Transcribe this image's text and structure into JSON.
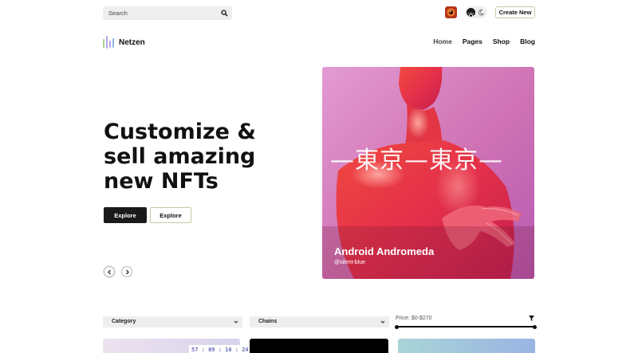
{
  "topbar": {
    "search_placeholder": "Search",
    "create_label": "Create New"
  },
  "brand": {
    "name": "Netzen",
    "logo_colors": [
      "#a9d18e",
      "#b8a6e8",
      "#8fb4ea"
    ]
  },
  "nav": {
    "items": [
      {
        "label": "Home",
        "active": true
      },
      {
        "label": "Pages",
        "active": false
      },
      {
        "label": "Shop",
        "active": false
      },
      {
        "label": "Blog",
        "active": false
      }
    ]
  },
  "hero": {
    "title_lines": [
      "Customize &",
      "sell amazing",
      "new NFTs"
    ],
    "primary_button": "Explore",
    "secondary_button": "Explore"
  },
  "featured": {
    "overlay_text": "—東京—東京—",
    "title": "Android Andromeda",
    "handle": "@silent-blue"
  },
  "filters": {
    "category_label": "Category",
    "chains_label": "Chains",
    "price_label": "Price:",
    "price_range": "$0-$270"
  },
  "cards": {
    "timer": "57 : 09 : 16 : 24"
  },
  "colors": {
    "accent_dark": "#1a1a1a",
    "outline": "#c9c9a8",
    "timer_text": "#6a6ab8"
  }
}
